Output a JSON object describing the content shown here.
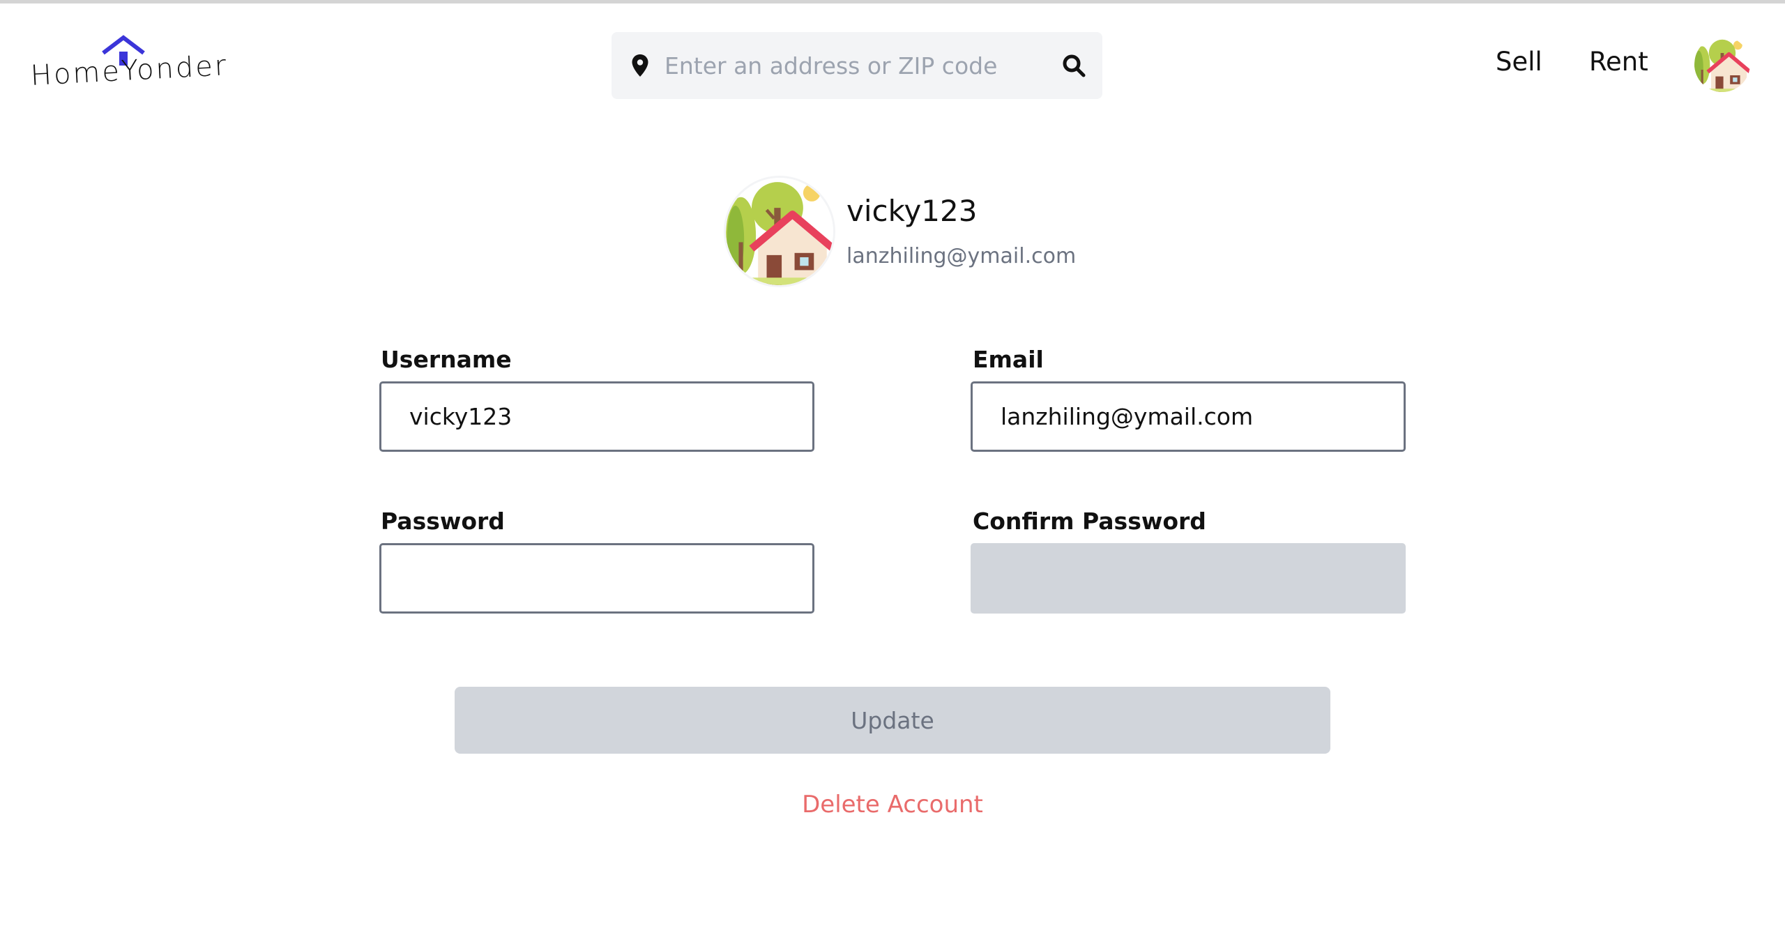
{
  "header": {
    "logo_text": "HomeYonder",
    "search_placeholder": "Enter an address or ZIP code",
    "search_value": "",
    "nav": {
      "sell": "Sell",
      "rent": "Rent"
    }
  },
  "profile": {
    "username": "vicky123",
    "email": "lanzhiling@ymail.com"
  },
  "form": {
    "username_label": "Username",
    "username_value": "vicky123",
    "email_label": "Email",
    "email_value": "lanzhiling@ymail.com",
    "password_label": "Password",
    "password_value": "",
    "confirm_label": "Confirm Password",
    "confirm_value": "",
    "update_label": "Update",
    "delete_label": "Delete Account"
  },
  "colors": {
    "brand": "#3b35d9",
    "danger": "#e96b6b",
    "disabled_bg": "#d1d5db"
  }
}
